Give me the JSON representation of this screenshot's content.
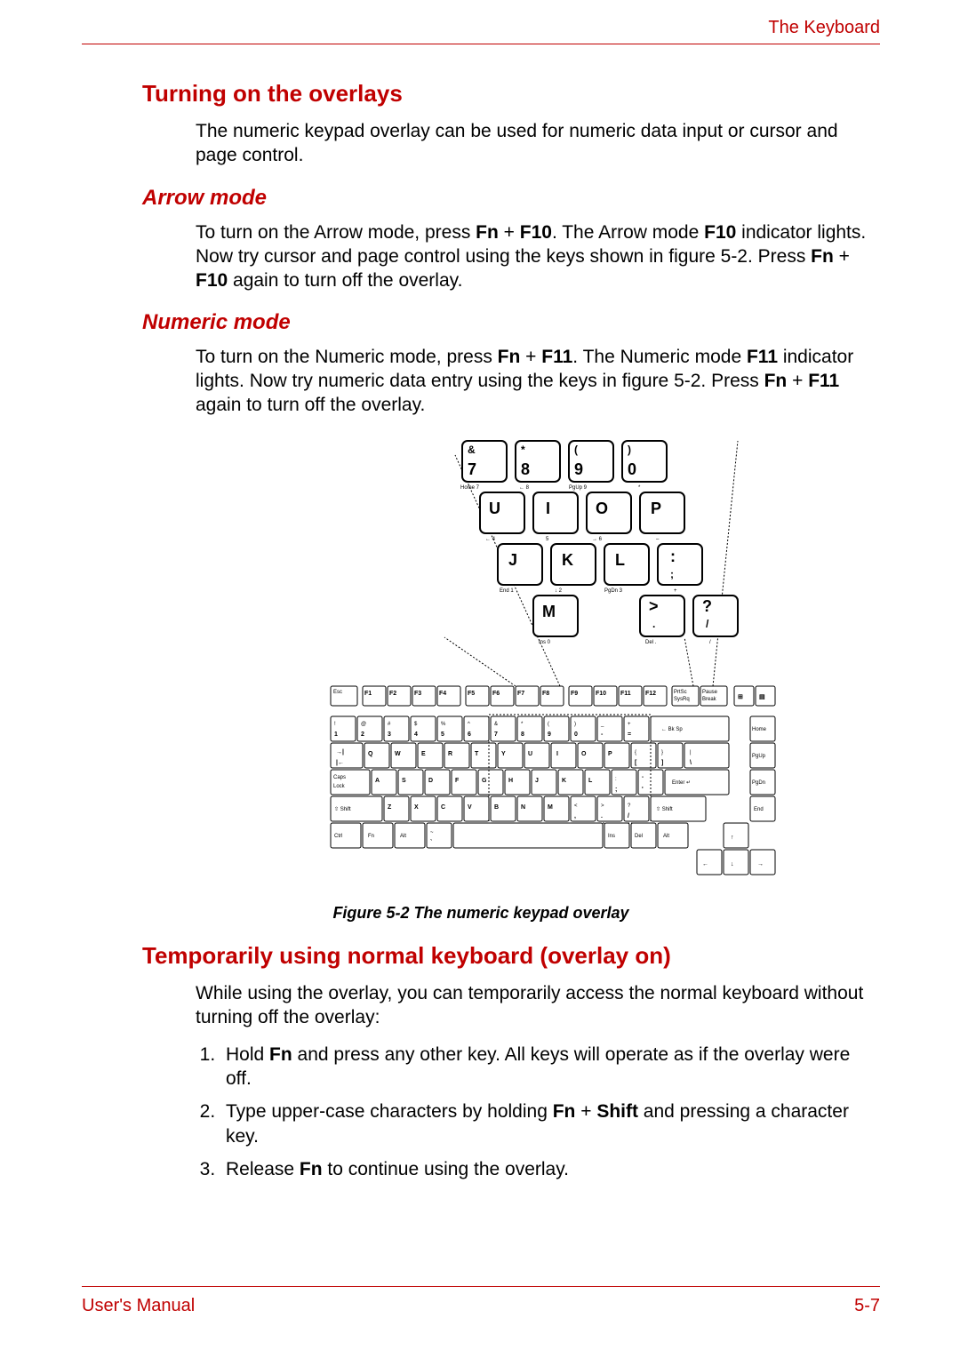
{
  "header": {
    "section": "The Keyboard"
  },
  "sections": {
    "s1_title": "Turning on the overlays",
    "s1_body": "The numeric keypad overlay can be used for numeric data input or cursor and page control.",
    "arrow_title": "Arrow mode",
    "arrow_p_pre": "To turn on the Arrow mode, press ",
    "arrow_k1": "Fn",
    "arrow_plus": " + ",
    "arrow_k2": "F10",
    "arrow_p_mid": ". The Arrow mode ",
    "arrow_k3": "F10",
    "arrow_p_after": " indicator lights. Now try cursor and page control using the keys shown in figure 5-2. Press ",
    "arrow_k4": "Fn",
    "arrow_k5": "F10",
    "arrow_p_end": " again to turn off the overlay.",
    "num_title": "Numeric mode",
    "num_p_pre": "To turn on the Numeric mode, press ",
    "num_k1": "Fn",
    "num_k2": "F11",
    "num_p_mid": ". The Numeric mode ",
    "num_k3": "F11",
    "num_p_after": " indicator lights. Now try numeric data entry using the keys in figure 5-2. Press ",
    "num_k4": "Fn",
    "num_k5": "F11",
    "num_p_end": " again to turn off the overlay.",
    "caption": "Figure 5-2 The numeric keypad overlay",
    "s2_title": "Temporarily using normal keyboard (overlay on)",
    "s2_intro": "While using the overlay, you can temporarily access the normal keyboard without turning off the overlay:",
    "step1_a": "Hold ",
    "step1_b": "Fn",
    "step1_c": " and press any other key. All keys will operate as if the overlay were off.",
    "step2_a": "Type upper-case characters by holding ",
    "step2_b": "Fn",
    "step2_c": " + ",
    "step2_d": "Shift",
    "step2_e": " and pressing a character key.",
    "step3_a": "Release ",
    "step3_b": "Fn",
    "step3_c": " to continue using the overlay."
  },
  "keyboard_overlay": {
    "enlarged_rows": [
      {
        "labels": [
          "Home",
          "←",
          "↑",
          "PgUp",
          "*"
        ],
        "keys": [
          {
            "top": "&",
            "bot": "7"
          },
          {
            "top": "*",
            "bot": "8"
          },
          {
            "top": "(",
            "bot": "9"
          },
          {
            "top": ")",
            "bot": "0"
          }
        ]
      },
      {
        "labels": [
          "←",
          "↓",
          "→",
          "–"
        ],
        "keys": [
          {
            "main": "U"
          },
          {
            "main": "I"
          },
          {
            "main": "O"
          },
          {
            "main": "P"
          }
        ]
      },
      {
        "labels": [
          "End",
          "↓",
          "PgDn",
          "+"
        ],
        "keys": [
          {
            "main": "J"
          },
          {
            "main": "K"
          },
          {
            "main": "L"
          },
          {
            "main": ";"
          }
        ]
      },
      {
        "labels": [
          "Ins",
          "",
          "Del",
          ""
        ],
        "keys": [
          {
            "main": "M"
          },
          {
            "main": ">",
            "bot": "."
          },
          {
            "main": "?",
            "bot": "/"
          }
        ]
      }
    ],
    "full_rows": {
      "fn_row": [
        "Esc",
        "F1",
        "F2",
        "F3",
        "F4",
        "F5",
        "F6",
        "F7",
        "F8",
        "F9",
        "F10",
        "F11",
        "F12",
        "PrtSc Sys Req",
        "Pause Break",
        "⊞",
        "▤"
      ],
      "num_row": [
        "!1",
        "@2",
        "#3",
        "$4",
        "%5",
        "^6",
        "&7",
        "*8",
        "(9",
        ")0",
        "_-",
        "+=",
        "← Bk Sp",
        "Home"
      ],
      "q_row": [
        "→|",
        "Q",
        "W",
        "E",
        "R",
        "T",
        "Y",
        "U",
        "I",
        "O",
        "P",
        "{[",
        "}]",
        "|\\",
        "PgUp"
      ],
      "a_row": [
        "Caps Lock",
        "A",
        "S",
        "D",
        "F",
        "G",
        "H",
        "J",
        "K",
        "L",
        ":;",
        "\"'",
        "Enter ↵",
        "PgDn"
      ],
      "z_row": [
        "⇧ Shift",
        "Z",
        "X",
        "C",
        "V",
        "B",
        "N",
        "M",
        "<,",
        ">.",
        "?/",
        "⇧ Shift",
        "End"
      ],
      "ctrl_row": [
        "Ctrl",
        "Fn",
        "Alt",
        "~`",
        "",
        "Ins",
        "Del",
        "Alt",
        "↑"
      ],
      "arrow_row": [
        "←",
        "↓",
        "→"
      ]
    }
  },
  "footer": {
    "left": "User's Manual",
    "right": "5-7"
  }
}
